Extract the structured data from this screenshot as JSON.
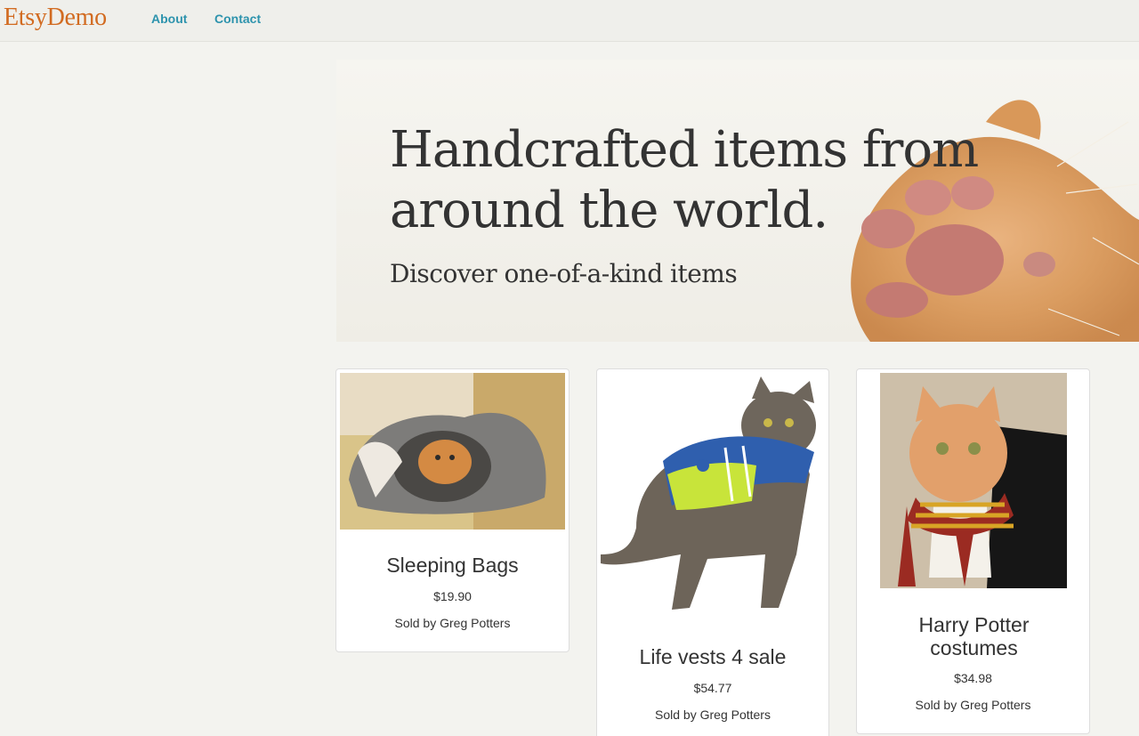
{
  "nav": {
    "brand": "EtsyDemo",
    "links": [
      {
        "label": "About"
      },
      {
        "label": "Contact"
      }
    ]
  },
  "hero": {
    "title": "Handcrafted items from around the world.",
    "subtitle": "Discover one-of-a-kind items"
  },
  "products": [
    {
      "title": "Sleeping Bags",
      "price": "$19.90",
      "seller": "Sold by Greg Potters"
    },
    {
      "title": "Life vests 4 sale",
      "price": "$54.77",
      "seller": "Sold by Greg Potters"
    },
    {
      "title": "Harry Potter costumes",
      "price": "$34.98",
      "seller": "Sold by Greg Potters"
    }
  ],
  "colors": {
    "brand": "#d26b21",
    "nav_link": "#2d93ad",
    "text": "#333333",
    "page_bg": "#f3f3ef"
  }
}
